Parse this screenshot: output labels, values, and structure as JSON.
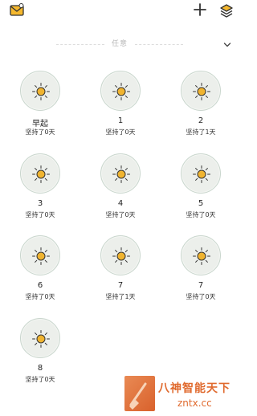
{
  "header": {
    "left_icon": "mail-icon",
    "right_icons": [
      "plus-icon",
      "layers-icon"
    ]
  },
  "filter": {
    "label": "任意",
    "icon": "chevron-down-icon"
  },
  "habits": [
    {
      "name": "早起",
      "count": "坚持了0天"
    },
    {
      "name": "1",
      "count": "坚持了0天"
    },
    {
      "name": "2",
      "count": "坚持了1天"
    },
    {
      "name": "3",
      "count": "坚持了0天"
    },
    {
      "name": "4",
      "count": "坚持了0天"
    },
    {
      "name": "5",
      "count": "坚持了0天"
    },
    {
      "name": "6",
      "count": "坚持了0天"
    },
    {
      "name": "7",
      "count": "坚持了1天"
    },
    {
      "name": "7",
      "count": "坚持了0天"
    },
    {
      "name": "8",
      "count": "坚持了0天"
    }
  ],
  "watermark": {
    "title": "八神智能天下",
    "url": "zntx.cc"
  },
  "colors": {
    "sun": "#f0b430",
    "circle_bg": "#ecefeb",
    "circle_border": "#c9d6cd",
    "accent": "#f5b82e",
    "watermark": "#e06a2e"
  }
}
